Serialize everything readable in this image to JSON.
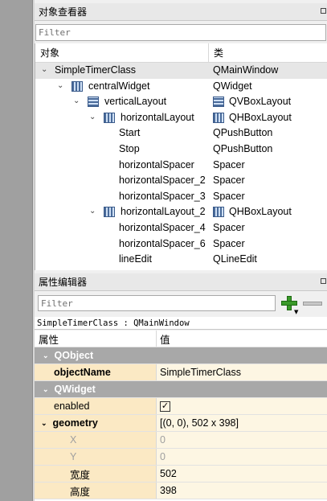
{
  "object_inspector": {
    "title": "对象查看器",
    "filter_placeholder": "Filter",
    "col_object": "对象",
    "col_class": "类",
    "rows": [
      {
        "name": "SimpleTimerClass",
        "cls": "QMainWindow"
      },
      {
        "name": "centralWidget",
        "cls": "QWidget"
      },
      {
        "name": "verticalLayout",
        "cls": "QVBoxLayout"
      },
      {
        "name": "horizontalLayout",
        "cls": "QHBoxLayout"
      },
      {
        "name": "Start",
        "cls": "QPushButton"
      },
      {
        "name": "Stop",
        "cls": "QPushButton"
      },
      {
        "name": "horizontalSpacer",
        "cls": "Spacer"
      },
      {
        "name": "horizontalSpacer_2",
        "cls": "Spacer"
      },
      {
        "name": "horizontalSpacer_3",
        "cls": "Spacer"
      },
      {
        "name": "horizontalLayout_2",
        "cls": "QHBoxLayout"
      },
      {
        "name": "horizontalSpacer_4",
        "cls": "Spacer"
      },
      {
        "name": "horizontalSpacer_6",
        "cls": "Spacer"
      },
      {
        "name": "lineEdit",
        "cls": "QLineEdit"
      }
    ]
  },
  "property_editor": {
    "title": "属性编辑器",
    "filter_placeholder": "Filter",
    "current_object": "SimpleTimerClass : QMainWindow",
    "col_property": "属性",
    "col_value": "值",
    "rows": [
      {
        "group": "QObject"
      },
      {
        "key": "objectName",
        "value": "SimpleTimerClass"
      },
      {
        "group": "QWidget"
      },
      {
        "key": "enabled",
        "value": "✓"
      },
      {
        "key": "geometry",
        "value": "[(0, 0), 502 x 398]"
      },
      {
        "key": "X",
        "value": "0"
      },
      {
        "key": "Y",
        "value": "0"
      },
      {
        "key": "宽度",
        "value": "502"
      },
      {
        "key": "高度",
        "value": "398"
      }
    ]
  }
}
